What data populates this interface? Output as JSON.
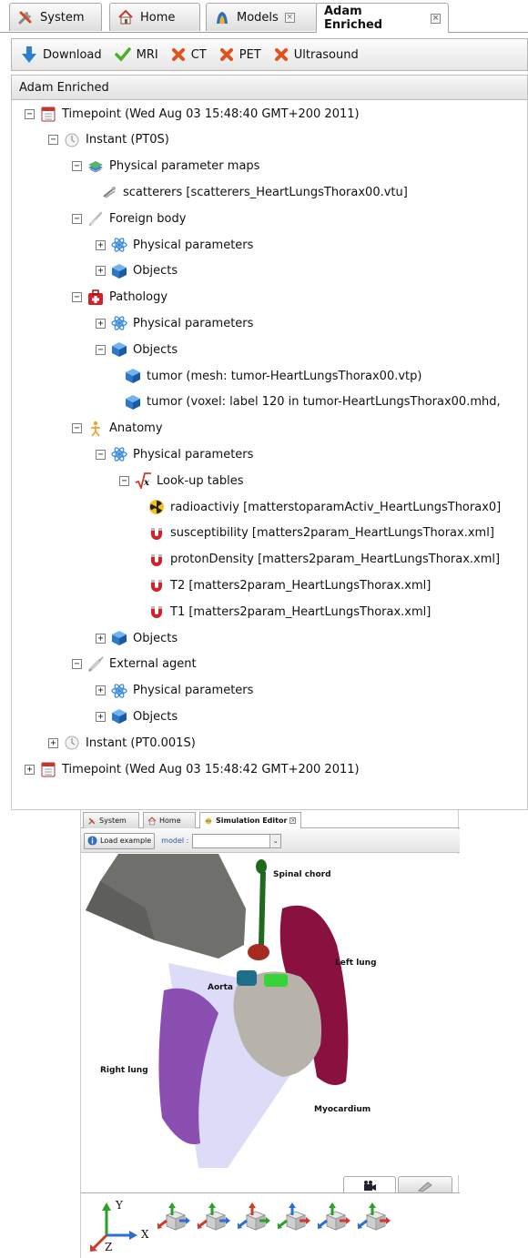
{
  "tabs": [
    {
      "label": "System",
      "icon": "tools-icon"
    },
    {
      "label": "Home",
      "icon": "home-icon"
    },
    {
      "label": "Models",
      "icon": "models-icon",
      "closable": true
    },
    {
      "label": "Adam Enriched",
      "icon": "none",
      "closable": true,
      "active": true
    }
  ],
  "toolbar": {
    "download": "Download",
    "mri": "MRI",
    "ct": "CT",
    "pet": "PET",
    "ultrasound": "Ultrasound"
  },
  "tree_header": "Adam Enriched",
  "tree": [
    {
      "label": "Timepoint (Wed Aug 03 15:48:40 GMT+200 2011)",
      "icon": "calendar-icon",
      "toggle": "-"
    },
    {
      "label": "Instant (PT0S)",
      "icon": "clock-icon",
      "toggle": "-"
    },
    {
      "label": "Physical parameter maps",
      "icon": "layers-icon",
      "toggle": "-"
    },
    {
      "label": "scatterers [scatterers_HeartLungsThorax00.vtu]",
      "icon": "scatter-icon",
      "toggle": ""
    },
    {
      "label": "Foreign body",
      "icon": "needle-icon",
      "toggle": "-"
    },
    {
      "label": "Physical parameters",
      "icon": "atom-icon",
      "toggle": "+"
    },
    {
      "label": "Objects",
      "icon": "cube-icon",
      "toggle": "+"
    },
    {
      "label": "Pathology",
      "icon": "medkit-icon",
      "toggle": "-"
    },
    {
      "label": "Physical parameters",
      "icon": "atom-icon",
      "toggle": "+"
    },
    {
      "label": "Objects",
      "icon": "cube-icon",
      "toggle": "-"
    },
    {
      "label": "tumor (mesh: tumor-HeartLungsThorax00.vtp)",
      "icon": "cube-icon",
      "toggle": ""
    },
    {
      "label": "tumor (voxel: label 120 in tumor-HeartLungsThorax00.mhd,",
      "icon": "cube-icon",
      "toggle": ""
    },
    {
      "label": "Anatomy",
      "icon": "person-icon",
      "toggle": "-"
    },
    {
      "label": "Physical parameters",
      "icon": "atom-icon",
      "toggle": "-"
    },
    {
      "label": "Look-up tables",
      "icon": "sqrt-icon",
      "toggle": "-"
    },
    {
      "label": "radioactiviy [matterstoparamActiv_HeartLungsThorax0]",
      "icon": "radiation-icon",
      "toggle": ""
    },
    {
      "label": "susceptibility [matters2param_HeartLungsThorax.xml]",
      "icon": "magnet-icon",
      "toggle": ""
    },
    {
      "label": "protonDensity [matters2param_HeartLungsThorax.xml]",
      "icon": "magnet-icon",
      "toggle": ""
    },
    {
      "label": "T2 [matters2param_HeartLungsThorax.xml]",
      "icon": "magnet-icon",
      "toggle": ""
    },
    {
      "label": "T1 [matters2param_HeartLungsThorax.xml]",
      "icon": "magnet-icon",
      "toggle": ""
    },
    {
      "label": "Objects",
      "icon": "cube-icon",
      "toggle": "+"
    },
    {
      "label": "External agent",
      "icon": "syringe-icon",
      "toggle": "-"
    },
    {
      "label": "Physical parameters",
      "icon": "atom-icon",
      "toggle": "+"
    },
    {
      "label": "Objects",
      "icon": "cube-icon",
      "toggle": "+"
    },
    {
      "label": "Instant (PT0.001S)",
      "icon": "clock-icon",
      "toggle": "+"
    },
    {
      "label": "Timepoint (Wed Aug 03 15:48:42 GMT+200 2011)",
      "icon": "calendar-icon",
      "toggle": "+"
    }
  ],
  "sim": {
    "tabs": [
      {
        "label": "System"
      },
      {
        "label": "Home"
      },
      {
        "label": "Simulation Editor",
        "active": true
      }
    ],
    "load_example": "Load example",
    "model_label": "model :",
    "model_value": "",
    "organs": {
      "spinal_chord": "Spinal chord",
      "left_lung": "Left lung",
      "aorta": "Aorta",
      "right_lung": "Right lung",
      "myocardium": "Myocardium"
    },
    "axes": {
      "x": "X",
      "y": "Y",
      "z": "Z"
    }
  },
  "colors": {
    "spinal_chord": "#1f6a1f",
    "left_lung": "#8a1040",
    "aorta": "#1e6e8a",
    "right_lung": "#8a4fb0",
    "myocardium": "#8a6a4a",
    "heart": "#b8b3aa",
    "cone": "#dcdcf8"
  }
}
